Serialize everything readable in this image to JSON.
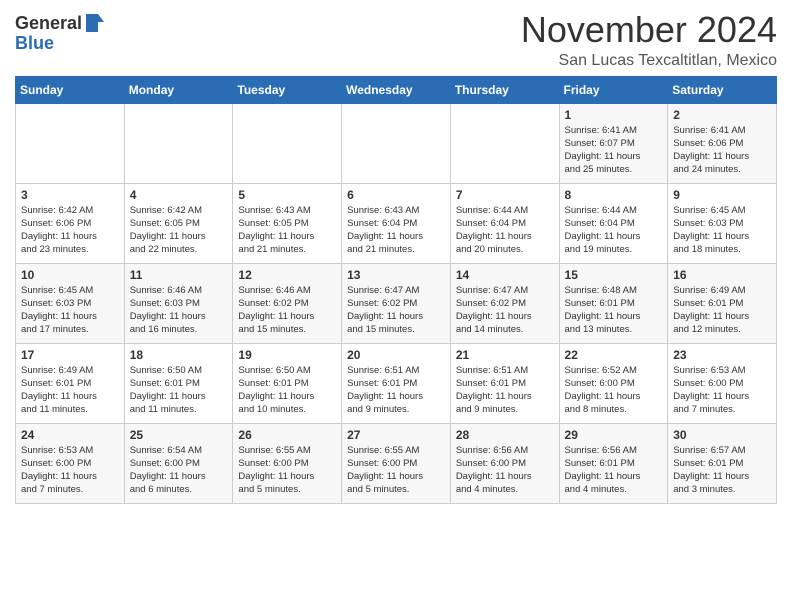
{
  "logo": {
    "general": "General",
    "blue": "Blue"
  },
  "title": "November 2024",
  "location": "San Lucas Texcaltitlan, Mexico",
  "weekdays": [
    "Sunday",
    "Monday",
    "Tuesday",
    "Wednesday",
    "Thursday",
    "Friday",
    "Saturday"
  ],
  "weeks": [
    [
      {
        "day": "",
        "info": ""
      },
      {
        "day": "",
        "info": ""
      },
      {
        "day": "",
        "info": ""
      },
      {
        "day": "",
        "info": ""
      },
      {
        "day": "",
        "info": ""
      },
      {
        "day": "1",
        "info": "Sunrise: 6:41 AM\nSunset: 6:07 PM\nDaylight: 11 hours\nand 25 minutes."
      },
      {
        "day": "2",
        "info": "Sunrise: 6:41 AM\nSunset: 6:06 PM\nDaylight: 11 hours\nand 24 minutes."
      }
    ],
    [
      {
        "day": "3",
        "info": "Sunrise: 6:42 AM\nSunset: 6:06 PM\nDaylight: 11 hours\nand 23 minutes."
      },
      {
        "day": "4",
        "info": "Sunrise: 6:42 AM\nSunset: 6:05 PM\nDaylight: 11 hours\nand 22 minutes."
      },
      {
        "day": "5",
        "info": "Sunrise: 6:43 AM\nSunset: 6:05 PM\nDaylight: 11 hours\nand 21 minutes."
      },
      {
        "day": "6",
        "info": "Sunrise: 6:43 AM\nSunset: 6:04 PM\nDaylight: 11 hours\nand 21 minutes."
      },
      {
        "day": "7",
        "info": "Sunrise: 6:44 AM\nSunset: 6:04 PM\nDaylight: 11 hours\nand 20 minutes."
      },
      {
        "day": "8",
        "info": "Sunrise: 6:44 AM\nSunset: 6:04 PM\nDaylight: 11 hours\nand 19 minutes."
      },
      {
        "day": "9",
        "info": "Sunrise: 6:45 AM\nSunset: 6:03 PM\nDaylight: 11 hours\nand 18 minutes."
      }
    ],
    [
      {
        "day": "10",
        "info": "Sunrise: 6:45 AM\nSunset: 6:03 PM\nDaylight: 11 hours\nand 17 minutes."
      },
      {
        "day": "11",
        "info": "Sunrise: 6:46 AM\nSunset: 6:03 PM\nDaylight: 11 hours\nand 16 minutes."
      },
      {
        "day": "12",
        "info": "Sunrise: 6:46 AM\nSunset: 6:02 PM\nDaylight: 11 hours\nand 15 minutes."
      },
      {
        "day": "13",
        "info": "Sunrise: 6:47 AM\nSunset: 6:02 PM\nDaylight: 11 hours\nand 15 minutes."
      },
      {
        "day": "14",
        "info": "Sunrise: 6:47 AM\nSunset: 6:02 PM\nDaylight: 11 hours\nand 14 minutes."
      },
      {
        "day": "15",
        "info": "Sunrise: 6:48 AM\nSunset: 6:01 PM\nDaylight: 11 hours\nand 13 minutes."
      },
      {
        "day": "16",
        "info": "Sunrise: 6:49 AM\nSunset: 6:01 PM\nDaylight: 11 hours\nand 12 minutes."
      }
    ],
    [
      {
        "day": "17",
        "info": "Sunrise: 6:49 AM\nSunset: 6:01 PM\nDaylight: 11 hours\nand 11 minutes."
      },
      {
        "day": "18",
        "info": "Sunrise: 6:50 AM\nSunset: 6:01 PM\nDaylight: 11 hours\nand 11 minutes."
      },
      {
        "day": "19",
        "info": "Sunrise: 6:50 AM\nSunset: 6:01 PM\nDaylight: 11 hours\nand 10 minutes."
      },
      {
        "day": "20",
        "info": "Sunrise: 6:51 AM\nSunset: 6:01 PM\nDaylight: 11 hours\nand 9 minutes."
      },
      {
        "day": "21",
        "info": "Sunrise: 6:51 AM\nSunset: 6:01 PM\nDaylight: 11 hours\nand 9 minutes."
      },
      {
        "day": "22",
        "info": "Sunrise: 6:52 AM\nSunset: 6:00 PM\nDaylight: 11 hours\nand 8 minutes."
      },
      {
        "day": "23",
        "info": "Sunrise: 6:53 AM\nSunset: 6:00 PM\nDaylight: 11 hours\nand 7 minutes."
      }
    ],
    [
      {
        "day": "24",
        "info": "Sunrise: 6:53 AM\nSunset: 6:00 PM\nDaylight: 11 hours\nand 7 minutes."
      },
      {
        "day": "25",
        "info": "Sunrise: 6:54 AM\nSunset: 6:00 PM\nDaylight: 11 hours\nand 6 minutes."
      },
      {
        "day": "26",
        "info": "Sunrise: 6:55 AM\nSunset: 6:00 PM\nDaylight: 11 hours\nand 5 minutes."
      },
      {
        "day": "27",
        "info": "Sunrise: 6:55 AM\nSunset: 6:00 PM\nDaylight: 11 hours\nand 5 minutes."
      },
      {
        "day": "28",
        "info": "Sunrise: 6:56 AM\nSunset: 6:00 PM\nDaylight: 11 hours\nand 4 minutes."
      },
      {
        "day": "29",
        "info": "Sunrise: 6:56 AM\nSunset: 6:01 PM\nDaylight: 11 hours\nand 4 minutes."
      },
      {
        "day": "30",
        "info": "Sunrise: 6:57 AM\nSunset: 6:01 PM\nDaylight: 11 hours\nand 3 minutes."
      }
    ]
  ]
}
